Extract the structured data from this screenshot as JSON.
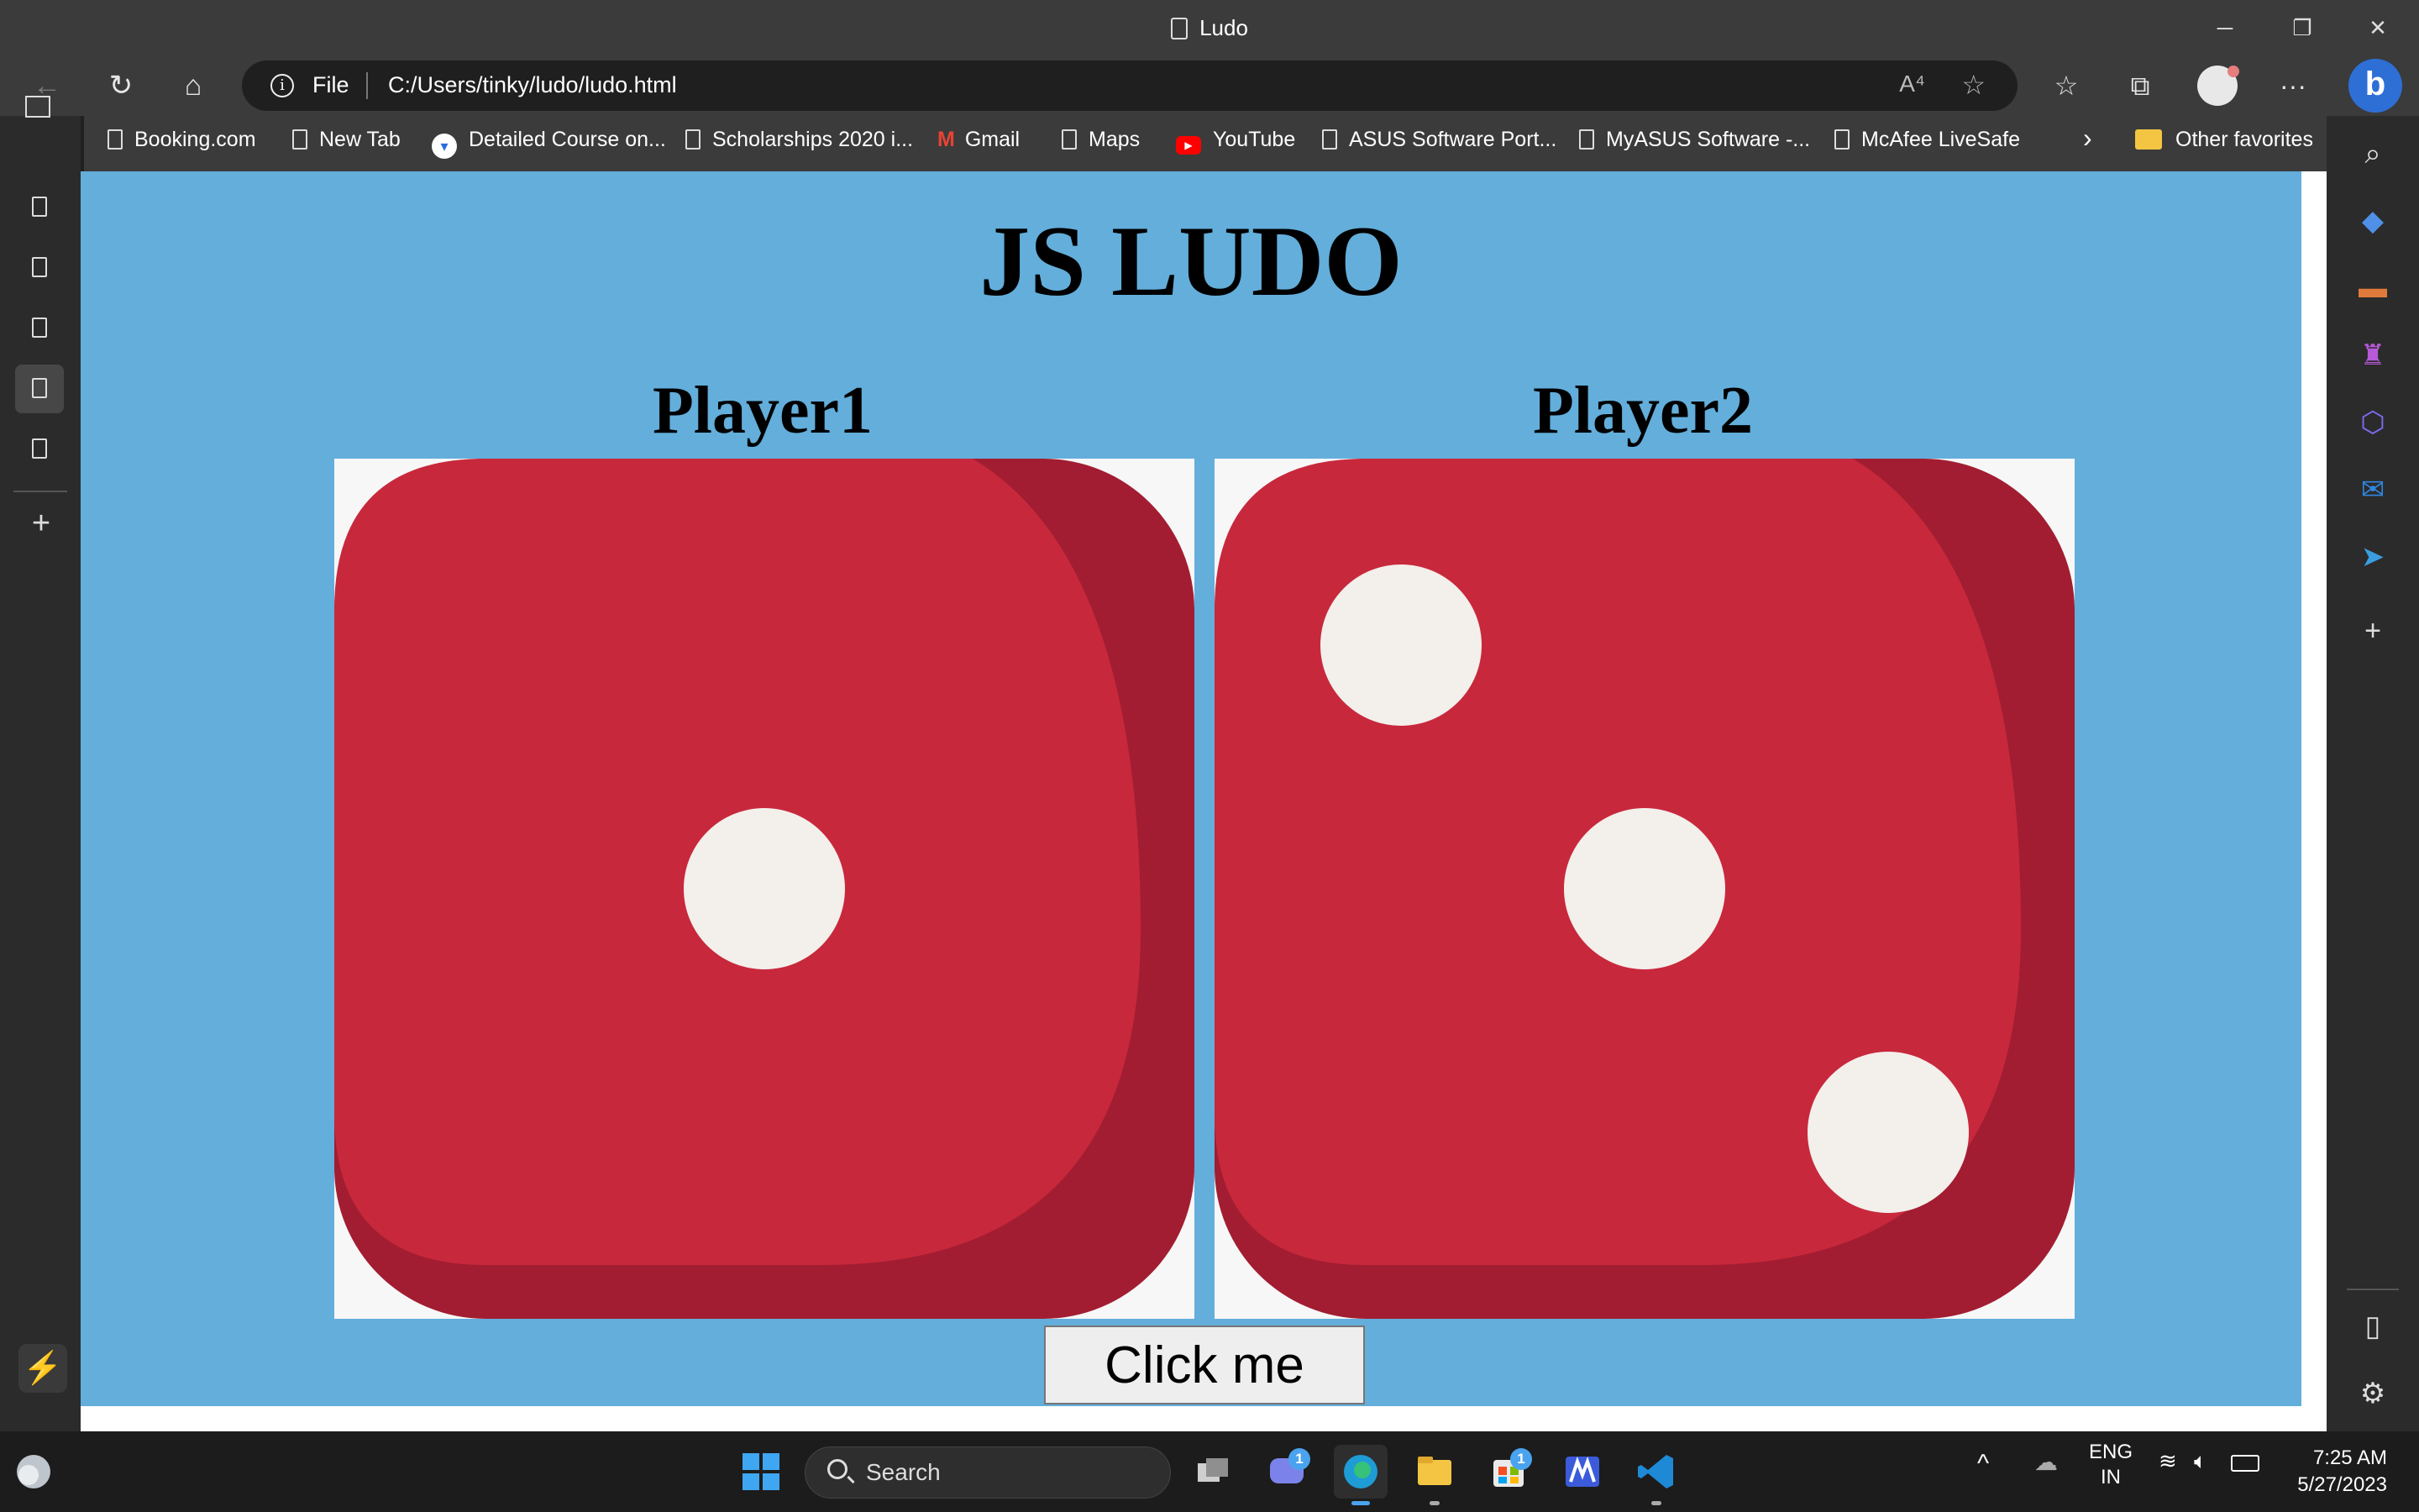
{
  "window": {
    "title": "Ludo",
    "min_glyph": "─",
    "restore_glyph": "❐",
    "close_glyph": "✕"
  },
  "toolbar": {
    "back_glyph": "←",
    "refresh_glyph": "↻",
    "home_glyph": "⌂",
    "info_glyph": "i",
    "address_scheme": "File",
    "address_url": "C:/Users/tinky/ludo/ludo.html",
    "read_aloud_glyph": "A⁴",
    "add_fav_glyph": "☆",
    "favorites_glyph": "☆",
    "collections_glyph": "⧉",
    "more_glyph": "···",
    "bing_glyph": "b"
  },
  "favorites": [
    {
      "label": "Booking.com",
      "icon": "page-icon"
    },
    {
      "label": "New Tab",
      "icon": "page-icon"
    },
    {
      "label": "Detailed Course on...",
      "icon": "course-icon"
    },
    {
      "label": "Scholarships 2020 i...",
      "icon": "page-icon"
    },
    {
      "label": "Gmail",
      "icon": "gmail-icon"
    },
    {
      "label": "Maps",
      "icon": "page-icon"
    },
    {
      "label": "YouTube",
      "icon": "youtube-icon"
    },
    {
      "label": "ASUS Software Port...",
      "icon": "page-icon"
    },
    {
      "label": "MyASUS Software -...",
      "icon": "page-icon"
    },
    {
      "label": "McAfee LiveSafe",
      "icon": "page-icon"
    }
  ],
  "favorites_more_glyph": "›",
  "other_favorites": "Other favorites",
  "vertical_tabs": {
    "count": 6,
    "active_index": 4,
    "plus_glyph": "+"
  },
  "right_sidebar": {
    "search_glyph": "⌕",
    "plus_glyph": "+",
    "panel_glyph": "▯",
    "settings_glyph": "⚙"
  },
  "page": {
    "heading": "JS LUDO",
    "player1_label": "Player1",
    "player2_label": "Player2",
    "player1_die_value": 1,
    "player2_die_value": 3,
    "die_color": "#c8283c",
    "die_shadow_color": "#a21d31",
    "pip_color": "#f3efeb",
    "background_color": "#63aedb",
    "button_label": "Click me"
  },
  "taskbar": {
    "search_label": "Search",
    "chat_badge": "1",
    "store_badge": "1",
    "tray_up_glyph": "^",
    "language_top": "ENG",
    "language_bottom": "IN",
    "time": "7:25 AM",
    "date": "5/27/2023"
  }
}
